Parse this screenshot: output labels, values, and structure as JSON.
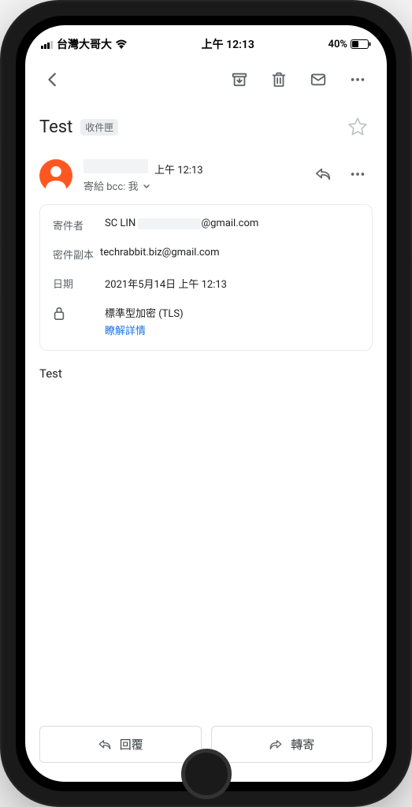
{
  "status": {
    "carrier": "台灣大哥大",
    "time": "上午 12:13",
    "battery_pct": "40%"
  },
  "subject": "Test",
  "label": "收件匣",
  "sender": {
    "time": "上午 12:13",
    "recipients_line": "寄給 bcc: 我"
  },
  "details": {
    "from_label": "寄件者",
    "from_name": "SC LIN",
    "from_domain": "@gmail.com",
    "bcc_label": "密件副本",
    "bcc_value": "techrabbit.biz@gmail.com",
    "date_label": "日期",
    "date_value": "2021年5月14日 上午 12:13",
    "security_text": "標準型加密 (TLS)",
    "security_link": "瞭解詳情"
  },
  "body": "Test",
  "actions": {
    "reply": "回覆",
    "forward": "轉寄"
  }
}
